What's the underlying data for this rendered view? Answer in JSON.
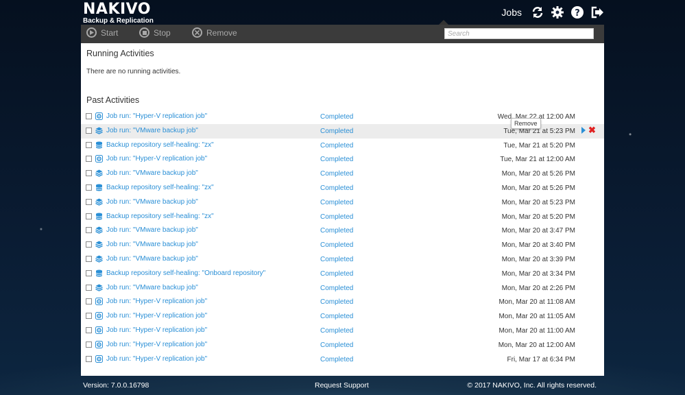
{
  "header": {
    "logo_main": "NAKIVO",
    "logo_sub": "Backup & Replication",
    "nav_jobs": "Jobs"
  },
  "toolbar": {
    "start_label": "Start",
    "stop_label": "Stop",
    "remove_label": "Remove",
    "search_placeholder": "Search"
  },
  "running": {
    "title": "Running Activities",
    "empty_message": "There are no running activities."
  },
  "past": {
    "title": "Past Activities",
    "rows": [
      {
        "icon": "hyperv-icon",
        "name": "Job run: \"Hyper-V replication job\"",
        "status": "Completed",
        "date": "Wed, Mar 22 at 12:00 AM"
      },
      {
        "icon": "vmware-icon",
        "name": "Job run: \"VMware backup job\"",
        "status": "Completed",
        "date": "Tue, Mar 21 at 5:23 PM"
      },
      {
        "icon": "repository-icon",
        "name": "Backup repository self-healing: \"zx\"",
        "status": "Completed",
        "date": "Tue, Mar 21 at 5:20 PM"
      },
      {
        "icon": "hyperv-icon",
        "name": "Job run: \"Hyper-V replication job\"",
        "status": "Completed",
        "date": "Tue, Mar 21 at 12:00 AM"
      },
      {
        "icon": "vmware-icon",
        "name": "Job run: \"VMware backup job\"",
        "status": "Completed",
        "date": "Mon, Mar 20 at 5:26 PM"
      },
      {
        "icon": "repository-icon",
        "name": "Backup repository self-healing: \"zx\"",
        "status": "Completed",
        "date": "Mon, Mar 20 at 5:26 PM"
      },
      {
        "icon": "vmware-icon",
        "name": "Job run: \"VMware backup job\"",
        "status": "Completed",
        "date": "Mon, Mar 20 at 5:23 PM"
      },
      {
        "icon": "repository-icon",
        "name": "Backup repository self-healing: \"zx\"",
        "status": "Completed",
        "date": "Mon, Mar 20 at 5:20 PM"
      },
      {
        "icon": "vmware-icon",
        "name": "Job run: \"VMware backup job\"",
        "status": "Completed",
        "date": "Mon, Mar 20 at 3:47 PM"
      },
      {
        "icon": "vmware-icon",
        "name": "Job run: \"VMware backup job\"",
        "status": "Completed",
        "date": "Mon, Mar 20 at 3:40 PM"
      },
      {
        "icon": "vmware-icon",
        "name": "Job run: \"VMware backup job\"",
        "status": "Completed",
        "date": "Mon, Mar 20 at 3:39 PM"
      },
      {
        "icon": "repository-icon",
        "name": "Backup repository self-healing: \"Onboard repository\"",
        "status": "Completed",
        "date": "Mon, Mar 20 at 3:34 PM"
      },
      {
        "icon": "vmware-icon",
        "name": "Job run: \"VMware backup job\"",
        "status": "Completed",
        "date": "Mon, Mar 20 at 2:26 PM"
      },
      {
        "icon": "hyperv-icon",
        "name": "Job run: \"Hyper-V replication job\"",
        "status": "Completed",
        "date": "Mon, Mar 20 at 11:08 AM"
      },
      {
        "icon": "hyperv-icon",
        "name": "Job run: \"Hyper-V replication job\"",
        "status": "Completed",
        "date": "Mon, Mar 20 at 11:05 AM"
      },
      {
        "icon": "hyperv-icon",
        "name": "Job run: \"Hyper-V replication job\"",
        "status": "Completed",
        "date": "Mon, Mar 20 at 11:00 AM"
      },
      {
        "icon": "hyperv-icon",
        "name": "Job run: \"Hyper-V replication job\"",
        "status": "Completed",
        "date": "Mon, Mar 20 at 12:00 AM"
      },
      {
        "icon": "hyperv-icon",
        "name": "Job run: \"Hyper-V replication job\"",
        "status": "Completed",
        "date": "Fri, Mar 17 at 6:34 PM"
      }
    ]
  },
  "tooltip": "Remove",
  "footer": {
    "version": "Version: 7.0.0.16798",
    "support": "Request Support",
    "copyright": "© 2017 NAKIVO, Inc. All rights reserved."
  },
  "colors": {
    "accent": "#2a8fd6",
    "toolbar": "#3b3b3b",
    "remove": "#e02020"
  }
}
